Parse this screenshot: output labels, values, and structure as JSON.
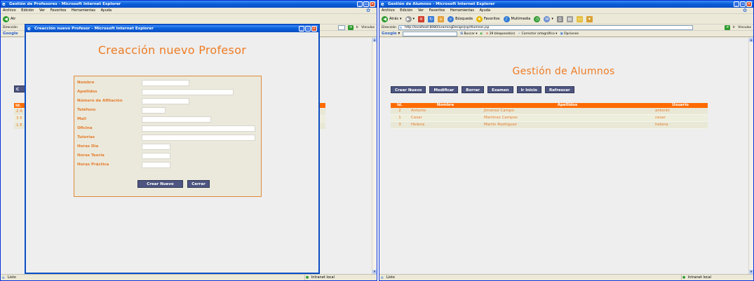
{
  "left_window": {
    "title": "Gestión de Profesores - Microsoft Internet Explorer",
    "menu": [
      "Archivo",
      "Edición",
      "Ver",
      "Favoritos",
      "Herramientas",
      "Ayuda"
    ],
    "back_partial": "Atr",
    "address_label": "Dirección",
    "google_label": "Google",
    "ir_label": "Ir",
    "vinculos_label": "Vínculos",
    "bg_button_partial": "C",
    "bg_table": {
      "header": "Id.",
      "rows": [
        {
          "id": "2",
          "name": "A"
        },
        {
          "id": "3",
          "name": "E"
        },
        {
          "id": "1",
          "name": "E"
        }
      ]
    },
    "status_text": "Listo",
    "zone_text": "Intranet local"
  },
  "modal": {
    "title": "Creacción nuevo Profesor - Microsoft Internet Explorer",
    "heading": "Creacción nuevo Profesor",
    "fields": [
      {
        "label": "Nombre",
        "name": "nombre"
      },
      {
        "label": "Apellidos",
        "name": "apellidos"
      },
      {
        "label": "Número de Afiliación",
        "name": "afiliacion"
      },
      {
        "label": "Teléfono",
        "name": "telefono"
      },
      {
        "label": "Mail",
        "name": "mail"
      },
      {
        "label": "Oficina",
        "name": "oficina"
      },
      {
        "label": "Tutorías",
        "name": "tutorias"
      },
      {
        "label": "Horas Día",
        "name": "horas-dia"
      },
      {
        "label": "Horas Teoría",
        "name": "horas-teoria"
      },
      {
        "label": "Horas Práctica",
        "name": "horas-practica"
      }
    ],
    "create_button": "Crear Nuevo",
    "close_button": "Cerrar"
  },
  "right_window": {
    "title": "Gestión de Alumnos - Microsoft Internet Explorer",
    "menu": [
      "Archivo",
      "Edición",
      "Ver",
      "Favoritos",
      "Herramientas",
      "Ayuda"
    ],
    "toolbar": {
      "back": "Atrás",
      "search": "Búsqueda",
      "favorites": "Favoritos",
      "multimedia": "Multimedia"
    },
    "address_label": "Dirección",
    "address_url": "http://localhost:8080/LearningDesign/jsp/Alumnos.jsp",
    "ir_label": "Ir",
    "vinculos_label": "Vínculos",
    "google": {
      "logo": "Google",
      "search": "Buscar",
      "blocked": "29 bloqueado(s)",
      "spell": "Corrector ortográfico",
      "options": "Opciones"
    },
    "heading": "Gestión de Alumnos",
    "buttons": [
      "Crear Nuevo",
      "Modificar",
      "Borrar",
      "Examen",
      "Ir Inicio",
      "Refrescar"
    ],
    "table": {
      "headers": [
        "Id.",
        "Nombre",
        "Apellidos",
        "Usuario"
      ],
      "rows": [
        [
          "2",
          "Antonio",
          "Jimenez Campo",
          "antonio"
        ],
        [
          "1",
          "Cesar",
          "Martinez Campos",
          "cesar"
        ],
        [
          "3",
          "Helena",
          "Martin Rodriguez",
          "helena"
        ]
      ]
    },
    "status_text": "Listo",
    "zone_text": "Intranet local"
  },
  "colors": {
    "xp_title": "#0a5fd9",
    "accent_orange": "#ff6b00",
    "button_navy": "#4d5580",
    "text_orange": "#e57c2c"
  }
}
